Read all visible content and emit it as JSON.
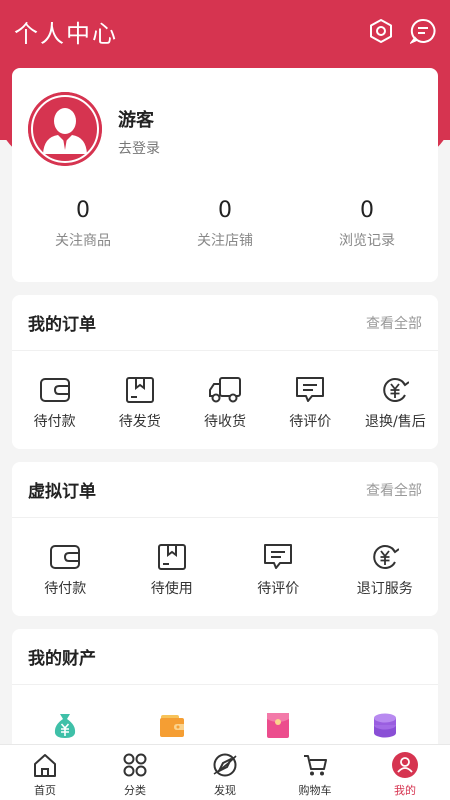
{
  "header": {
    "title": "个人中心",
    "settings_icon": "hexagon-settings-icon",
    "message_icon": "message-icon"
  },
  "profile": {
    "name": "游客",
    "login_text": "去登录",
    "stats": [
      {
        "value": "0",
        "label": "关注商品"
      },
      {
        "value": "0",
        "label": "关注店铺"
      },
      {
        "value": "0",
        "label": "浏览记录"
      }
    ]
  },
  "orders": {
    "title": "我的订单",
    "more": "查看全部",
    "items": [
      {
        "label": "待付款",
        "icon": "wallet-icon"
      },
      {
        "label": "待发货",
        "icon": "box-icon"
      },
      {
        "label": "待收货",
        "icon": "truck-icon"
      },
      {
        "label": "待评价",
        "icon": "comment-icon"
      },
      {
        "label": "退换/售后",
        "icon": "yuan-icon"
      }
    ]
  },
  "virtual_orders": {
    "title": "虚拟订单",
    "more": "查看全部",
    "items": [
      {
        "label": "待付款",
        "icon": "wallet-icon"
      },
      {
        "label": "待使用",
        "icon": "box-icon"
      },
      {
        "label": "待评价",
        "icon": "comment-icon"
      },
      {
        "label": "退订服务",
        "icon": "yuan-icon"
      }
    ]
  },
  "assets": {
    "title": "我的财产",
    "icons": [
      "money-bag-icon",
      "wallet-orange-icon",
      "red-envelope-icon",
      "coins-stack-icon"
    ]
  },
  "tabbar": {
    "items": [
      {
        "label": "首页",
        "icon": "home-icon"
      },
      {
        "label": "分类",
        "icon": "grid-icon"
      },
      {
        "label": "发现",
        "icon": "compass-icon"
      },
      {
        "label": "购物车",
        "icon": "cart-icon"
      },
      {
        "label": "我的",
        "icon": "user-icon",
        "active": true
      }
    ]
  },
  "colors": {
    "brand": "#d63450",
    "background": "#f4f4f4"
  }
}
